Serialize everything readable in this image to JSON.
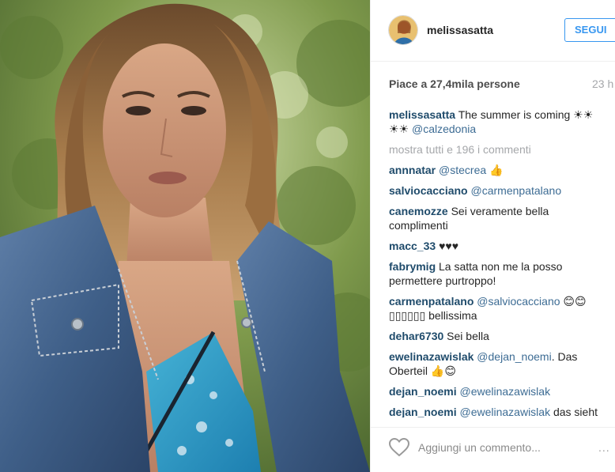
{
  "header": {
    "username": "melissasatta",
    "follow_label": "SEGUI"
  },
  "stats": {
    "likes_text": "Piace a 27,4mila persone",
    "time_text": "23 h"
  },
  "caption": {
    "user": "melissasatta",
    "text": "The summer is coming ☀☀ ☀☀ ",
    "mention": "@calzedonia"
  },
  "view_all_text": "mostra tutti e 196 i commenti",
  "comments": [
    {
      "user": "annnatar",
      "mention": "@stecrea",
      "text": " 👍"
    },
    {
      "user": "salviocacciano",
      "mention": "@carmenpatalano",
      "text": ""
    },
    {
      "user": "canemozze",
      "mention": "",
      "text": "Sei veramente bella complimenti"
    },
    {
      "user": "macc_33",
      "mention": "",
      "text": "♥♥♥"
    },
    {
      "user": "fabrymig",
      "mention": "",
      "text": "La satta non me la posso permettere purtroppo!"
    },
    {
      "user": "carmenpatalano",
      "mention": "@salviocacciano",
      "text": " 😊😊 ▯▯▯▯▯▯ bellissima"
    },
    {
      "user": "dehar6730",
      "mention": "",
      "text": "Sei bella"
    },
    {
      "user": "ewelinazawislak",
      "mention": "@dejan_noemi",
      "text": ". Das Oberteil 👍😊"
    },
    {
      "user": "dejan_noemi",
      "mention": "@ewelinazawislak",
      "text": ""
    },
    {
      "user": "dejan_noemi",
      "mention": "@ewelinazawislak",
      "text": " das sieht angezogen Mega aus 👟 @clz"
    }
  ],
  "footer": {
    "comment_placeholder": "Aggiungi un commento...",
    "more_options": "..."
  },
  "colors": {
    "follow_blue": "#3897f0",
    "username": "#1f4b6b",
    "mention": "#3d6c94",
    "muted": "#a5a7aa"
  },
  "icons": {
    "like": "heart-outline-icon",
    "options": "ellipsis-icon"
  }
}
